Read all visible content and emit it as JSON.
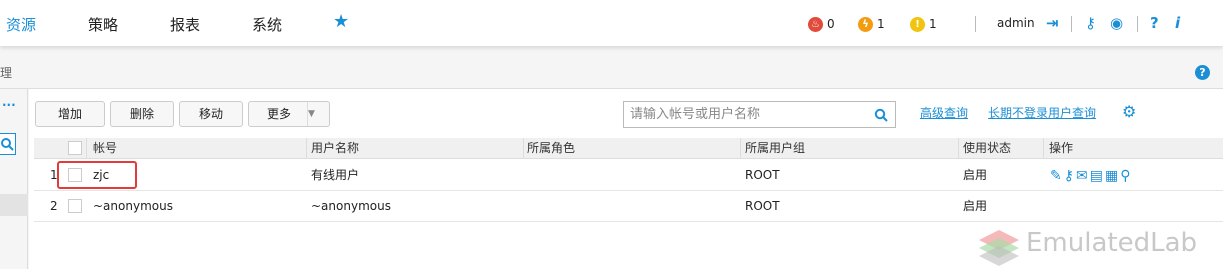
{
  "nav": {
    "items": [
      "资源",
      "策略",
      "报表",
      "系统"
    ],
    "star": "★"
  },
  "status": {
    "red_count": "0",
    "orange_count": "1",
    "yellow_count": "1"
  },
  "user": {
    "name": "admin"
  },
  "top_icons": [
    "logout-icon",
    "key-icon",
    "settings-eye-icon",
    "help-icon",
    "info-icon"
  ],
  "breadcrumb": "理",
  "sidebar": {
    "more": "···"
  },
  "toolbar": {
    "add": "增加",
    "delete": "删除",
    "move": "移动",
    "more": "更多",
    "search_placeholder": "请输入帐号或用户名称",
    "advanced_search": "高级查询",
    "inactive_search": "长期不登录用户查询"
  },
  "table": {
    "headers": [
      "帐号",
      "用户名称",
      "所属角色",
      "所属用户组",
      "使用状态",
      "操作"
    ],
    "rows": [
      {
        "index": "1",
        "account": "zjc",
        "username": "有线用户",
        "role": "",
        "group": "ROOT",
        "state": "启用"
      },
      {
        "index": "2",
        "account": "~anonymous",
        "username": "~anonymous",
        "role": "",
        "group": "ROOT",
        "state": "启用"
      }
    ]
  },
  "colors": {
    "accent": "#1b8fd6",
    "highlight": "#e23b3b"
  },
  "watermark": "EmulatedLab"
}
